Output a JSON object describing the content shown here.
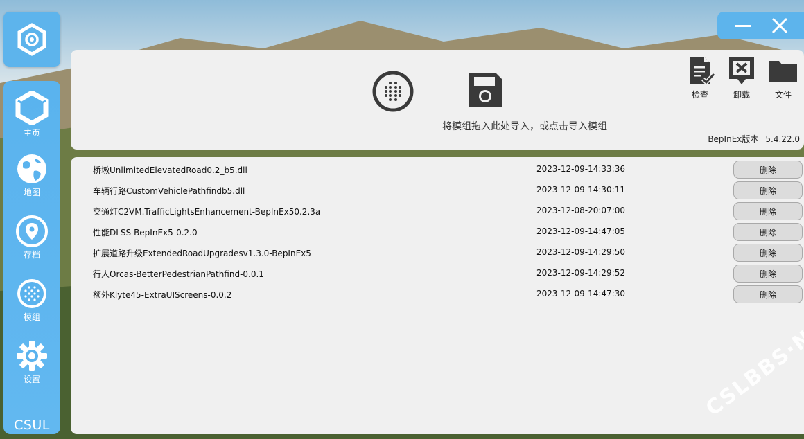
{
  "sidebar": {
    "items": [
      {
        "label": "主页",
        "icon": "home-hex-icon"
      },
      {
        "label": "地图",
        "icon": "globe-icon"
      },
      {
        "label": "存档",
        "icon": "location-pin-icon"
      },
      {
        "label": "模组",
        "icon": "mods-dots-icon"
      },
      {
        "label": "设置",
        "icon": "gear-icon"
      }
    ],
    "brand": "CSUL"
  },
  "window": {
    "minimize_icon": "minimize-icon",
    "close_icon": "close-icon"
  },
  "import": {
    "hint": "将模组拖入此处导入，或点击导入模组"
  },
  "tools": {
    "check_label": "检查",
    "uninstall_label": "卸载",
    "files_label": "文件"
  },
  "version": {
    "label": "BepInEx版本",
    "value": "5.4.22.0"
  },
  "mods": [
    {
      "name": "桥墩UnlimitedElevatedRoad0.2_b5.dll",
      "date": "2023-12-09-14:33:36",
      "action": "删除"
    },
    {
      "name": "车辆行路CustomVehiclePathfindb5.dll",
      "date": "2023-12-09-14:30:11",
      "action": "删除"
    },
    {
      "name": "交通灯C2VM.TrafficLightsEnhancement-BepInEx50.2.3a",
      "date": "2023-12-08-20:07:00",
      "action": "删除"
    },
    {
      "name": "性能DLSS-BepInEx5-0.2.0",
      "date": "2023-12-09-14:47:05",
      "action": "删除"
    },
    {
      "name": "扩展道路升级ExtendedRoadUpgradesv1.3.0-BepInEx5",
      "date": "2023-12-09-14:29:50",
      "action": "删除"
    },
    {
      "name": "行人Orcas-BetterPedestrianPathfind-0.0.1",
      "date": "2023-12-09-14:29:52",
      "action": "删除"
    },
    {
      "name": "额外Klyte45-ExtraUIScreens-0.0.2",
      "date": "2023-12-09-14:47:30",
      "action": "删除"
    }
  ],
  "watermark": "CSLBBS·NET",
  "colors": {
    "accent": "#5db4ec",
    "panel": "#f0f0f0",
    "icon_dark": "#3a3a3a"
  }
}
